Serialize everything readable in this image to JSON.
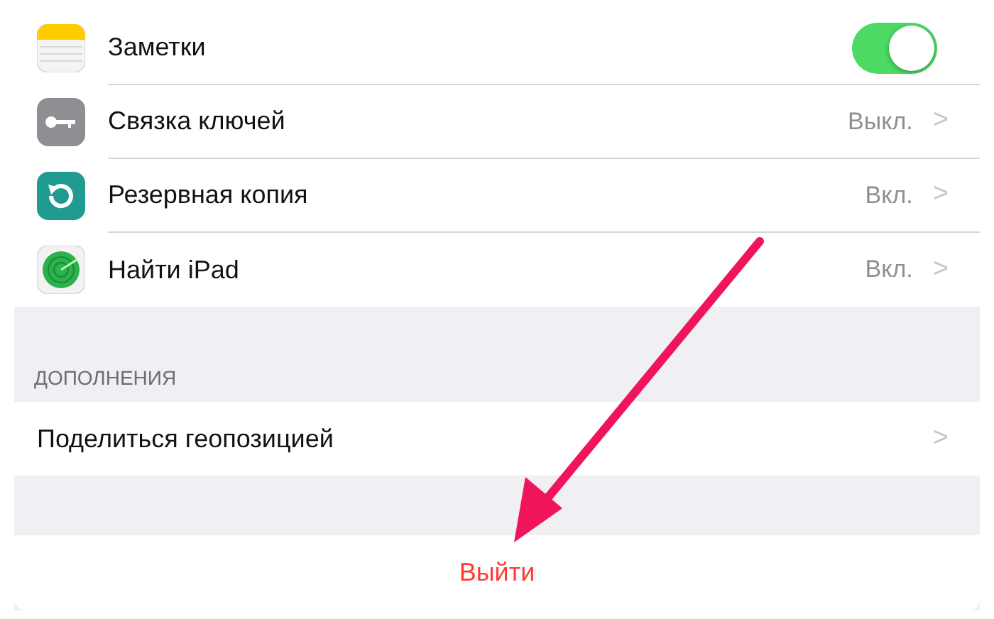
{
  "apps": [
    {
      "label": "Заметки",
      "kind": "toggle",
      "on": true
    },
    {
      "label": "Связка ключей",
      "kind": "detail",
      "value": "Выкл.",
      "chevron": ">"
    },
    {
      "label": "Резервная копия",
      "kind": "detail",
      "value": "Вкл.",
      "chevron": ">"
    },
    {
      "label": "Найти iPad",
      "kind": "detail",
      "value": "Вкл.",
      "chevron": ">"
    }
  ],
  "extras": {
    "header": "ДОПОЛНЕНИЯ",
    "items": [
      {
        "label": "Поделиться геопозицией",
        "chevron": ">"
      }
    ]
  },
  "sign_out": {
    "label": "Выйти"
  }
}
